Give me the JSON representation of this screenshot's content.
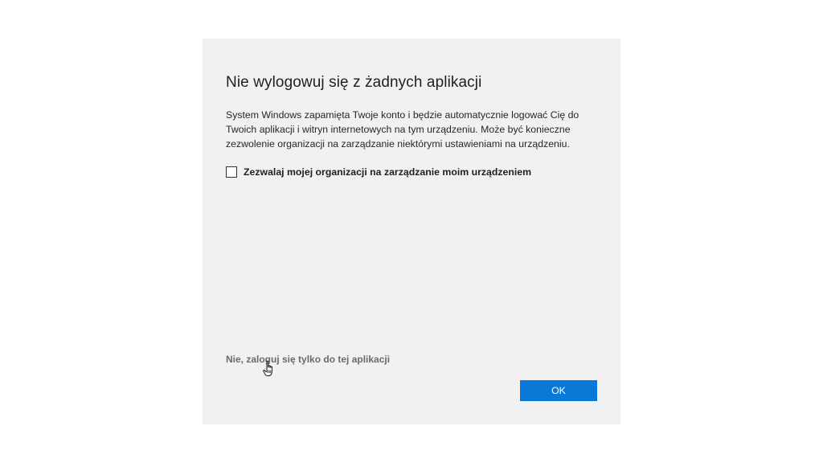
{
  "dialog": {
    "title": "Nie wylogowuj się z żadnych aplikacji",
    "description": "System Windows zapamięta Twoje konto i będzie automatycznie logować Cię do Twoich aplikacji i witryn internetowych na tym urządzeniu. Może być konieczne zezwolenie organizacji na zarządzanie niektórymi ustawieniami na urządzeniu.",
    "checkbox": {
      "label": "Zezwalaj mojej organizacji na zarządzanie moim urządzeniem",
      "checked": false
    },
    "link_text": "Nie, zaloguj się tylko do tej aplikacji",
    "ok_label": "OK",
    "colors": {
      "accent": "#0a78d7",
      "background": "#f1f1f1"
    }
  },
  "cursor": {
    "icon": "hand-pointer-icon"
  }
}
